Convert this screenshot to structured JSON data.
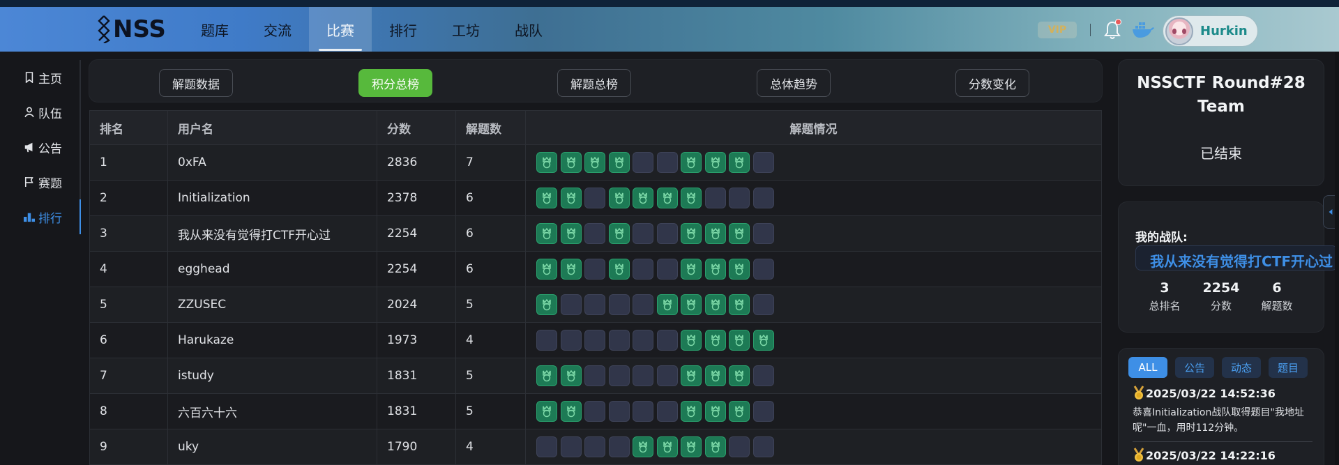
{
  "header": {
    "logo_text": "NSS",
    "nav": [
      {
        "label": "题库"
      },
      {
        "label": "交流"
      },
      {
        "label": "比赛",
        "active": true
      },
      {
        "label": "排行"
      },
      {
        "label": "工坊"
      },
      {
        "label": "战队"
      }
    ],
    "vip_label": "VIP",
    "username": "Hurkin"
  },
  "sidebar": {
    "items": [
      {
        "label": "主页",
        "icon": "bookmark-icon"
      },
      {
        "label": "队伍",
        "icon": "user-icon"
      },
      {
        "label": "公告",
        "icon": "megaphone-icon"
      },
      {
        "label": "赛题",
        "icon": "flag-icon"
      },
      {
        "label": "排行",
        "icon": "ranking-icon",
        "active": true
      }
    ]
  },
  "tabs": [
    {
      "label": "解题数据"
    },
    {
      "label": "积分总榜",
      "active": true
    },
    {
      "label": "解题总榜"
    },
    {
      "label": "总体趋势"
    },
    {
      "label": "分数变化"
    }
  ],
  "table": {
    "headers": [
      "排名",
      "用户名",
      "分数",
      "解题数",
      "解题情况"
    ],
    "rows": [
      {
        "rank": "1",
        "user": "0xFA",
        "score": "2836",
        "solved": "7",
        "status": [
          1,
          1,
          1,
          1,
          0,
          0,
          1,
          1,
          1,
          0
        ]
      },
      {
        "rank": "2",
        "user": "Initialization",
        "score": "2378",
        "solved": "6",
        "status": [
          1,
          1,
          0,
          1,
          1,
          1,
          1,
          0,
          0,
          0
        ]
      },
      {
        "rank": "3",
        "user": "我从来没有觉得打CTF开心过",
        "score": "2254",
        "solved": "6",
        "status": [
          1,
          1,
          0,
          1,
          0,
          0,
          1,
          1,
          1,
          0
        ]
      },
      {
        "rank": "4",
        "user": "egghead",
        "score": "2254",
        "solved": "6",
        "status": [
          1,
          1,
          0,
          1,
          0,
          0,
          1,
          1,
          1,
          0
        ]
      },
      {
        "rank": "5",
        "user": "ZZUSEC",
        "score": "2024",
        "solved": "5",
        "status": [
          1,
          0,
          0,
          0,
          0,
          1,
          1,
          1,
          1,
          0
        ]
      },
      {
        "rank": "6",
        "user": "Harukaze",
        "score": "1973",
        "solved": "4",
        "status": [
          0,
          0,
          0,
          0,
          0,
          0,
          1,
          1,
          1,
          1
        ]
      },
      {
        "rank": "7",
        "user": "istudy",
        "score": "1831",
        "solved": "5",
        "status": [
          1,
          1,
          0,
          0,
          0,
          0,
          1,
          1,
          1,
          0
        ]
      },
      {
        "rank": "8",
        "user": "六百六十六",
        "score": "1831",
        "solved": "5",
        "status": [
          1,
          1,
          0,
          0,
          0,
          0,
          1,
          1,
          1,
          0
        ]
      },
      {
        "rank": "9",
        "user": "uky",
        "score": "1790",
        "solved": "4",
        "status": [
          0,
          0,
          0,
          0,
          1,
          1,
          1,
          1,
          0,
          0
        ]
      }
    ]
  },
  "competition": {
    "title_line1": "NSSCTF Round#28",
    "title_line2": "Team",
    "status": "已结束"
  },
  "my_team": {
    "label": "我的战队:",
    "name": "我从来没有觉得打CTF开心过",
    "stats": [
      {
        "value": "3",
        "label": "总排名"
      },
      {
        "value": "2254",
        "label": "分数"
      },
      {
        "value": "6",
        "label": "解题数"
      }
    ]
  },
  "feed": {
    "tabs": [
      {
        "label": "ALL",
        "active": true
      },
      {
        "label": "公告"
      },
      {
        "label": "动态"
      },
      {
        "label": "题目"
      }
    ],
    "items": [
      {
        "time": "2025/03/22 14:52:36",
        "text": "恭喜Initialization战队取得题目\"我地址呢\"一血，用时112分钟。"
      },
      {
        "time": "2025/03/22 14:22:16",
        "text": ""
      }
    ]
  },
  "colors": {
    "accent_blue": "#3e8fe6",
    "tab_active_green": "#57b93c",
    "solved_green": "#1d7a55",
    "unsolved_slate": "#31364a"
  }
}
